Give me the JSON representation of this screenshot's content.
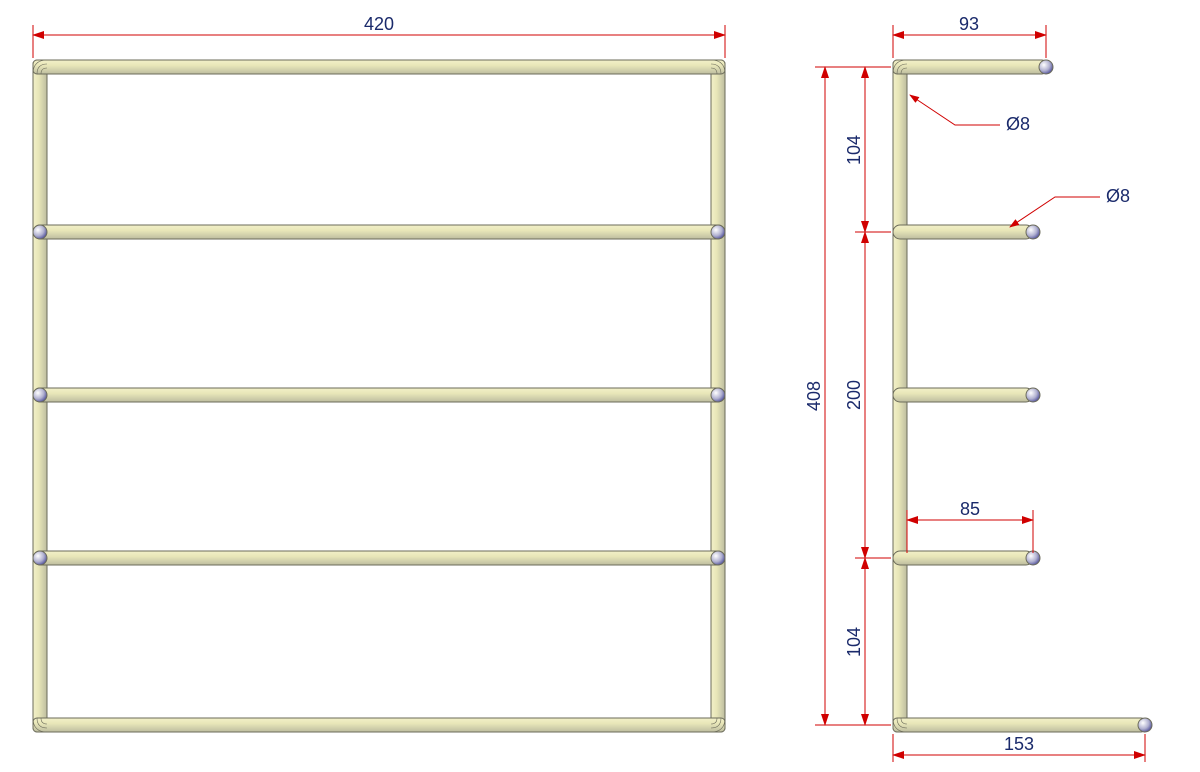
{
  "front_view": {
    "width_dim": "420"
  },
  "side_view": {
    "top_arm_length": "93",
    "total_height": "408",
    "spacing_top": "104",
    "spacing_mid": "200",
    "spacing_bottom": "104",
    "mid_arm_length": "85",
    "bottom_arm_length": "153",
    "diameter_top": "Ø8",
    "diameter_arm": "Ø8"
  },
  "chart_data": {
    "type": "table",
    "description": "Engineering drawing of a wire-form rack, two orthographic views",
    "front_view": {
      "overall_width_mm": 420,
      "overall_height_mm": 408,
      "horizontal_bars": 5,
      "vertical_bars": 2,
      "wire_diameter_mm": 8
    },
    "side_view": {
      "top_arm_length_mm": 93,
      "bottom_arm_length_mm": 153,
      "intermediate_arm_length_mm": 85,
      "total_height_mm": 408,
      "top_to_first_gap_mm": 104,
      "middle_section_height_mm": 200,
      "last_to_bottom_gap_mm": 104,
      "wire_diameter_mm": 8,
      "arms_count": 5
    }
  }
}
